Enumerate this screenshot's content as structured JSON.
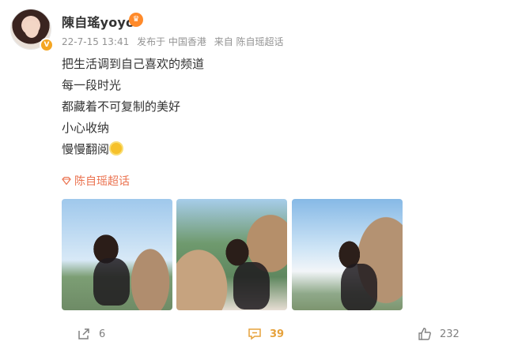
{
  "post": {
    "username": "陳自瑤yoyo",
    "meta": {
      "date": "22-7-15 13:41",
      "published_in": "发布于 中国香港",
      "source": "来自 陈自瑶超话"
    },
    "content_lines": [
      "把生活调到自己喜欢的频道",
      "每一段时光",
      "都藏着不可复制的美好",
      "小心收纳",
      "慢慢翻阅"
    ],
    "topic_label": "陈自瑶超话",
    "photos": [
      "photo-1",
      "photo-2",
      "photo-3"
    ]
  },
  "actions": {
    "share_count": "6",
    "comment_count": "39",
    "like_count": "232"
  },
  "colors": {
    "accent_orange": "#eb7350",
    "comment_orange": "#e6a23c",
    "meta_gray": "#939393",
    "text_dark": "#333333"
  }
}
